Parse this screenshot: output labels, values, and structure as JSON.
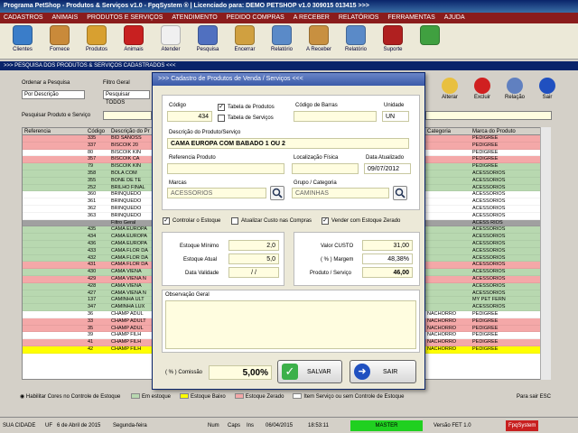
{
  "window": {
    "title": "Programa PetShop - Produtos & Serviços v1.0 - FpqSystem ® | Licenciado para: DEMO PETSHOP v1.0 309015 013415 >>>"
  },
  "menu": [
    "CADASTROS",
    "ANIMAIS",
    "PRODUTOS E SERVIÇOS",
    "ATENDIMENTO",
    "PEDIDO COMPRAS",
    "A RECEBER",
    "RELATÓRIOS",
    "FERRAMENTAS",
    "AJUDA"
  ],
  "toolbar": [
    {
      "label": "Clientes",
      "icon": "people-icon",
      "color": "#3a7dc9"
    },
    {
      "label": "Fornece",
      "icon": "supplier-icon",
      "color": "#c98a3a"
    },
    {
      "label": "Produtos",
      "icon": "boxes-icon",
      "color": "#d8a030"
    },
    {
      "label": "Animais",
      "icon": "paw-icon",
      "color": "#c82020"
    },
    {
      "label": "Atender",
      "icon": "vet-cross-icon",
      "color": "#f0f0f0"
    },
    {
      "label": "Pesquisa",
      "icon": "search-doc-icon",
      "color": "#5070c0"
    },
    {
      "label": "Encerrar",
      "icon": "folder-icon",
      "color": "#d0a040"
    },
    {
      "label": "Relatório",
      "icon": "report-icon",
      "color": "#5a8ac8"
    },
    {
      "label": "A Receber",
      "icon": "money-icon",
      "color": "#c89040"
    },
    {
      "label": "Relatório",
      "icon": "report-icon",
      "color": "#5a8ac8"
    },
    {
      "label": "Suporte",
      "icon": "support-icon",
      "color": "#b02020"
    },
    {
      "label": "",
      "icon": "exit-icon",
      "color": "#40a040"
    }
  ],
  "search_bar": {
    "title": ">>>  PESQUISA DOS PRODUTOS & SERVIÇOS CADASTRADOS  <<<"
  },
  "filters": {
    "order_label": "Ordenar a Pesquisa",
    "order_value": "Por Descrição",
    "filter_label": "Filtro Geral",
    "filter_value": "Pesquisar TODOS",
    "search_label": "Pesquisar Produto e Serviço"
  },
  "actions": [
    {
      "label": "Alterar",
      "icon": "edit-icon",
      "color": "#e8c040"
    },
    {
      "label": "Excluir",
      "icon": "delete-icon",
      "color": "#d02020"
    },
    {
      "label": "Relação",
      "icon": "print-icon",
      "color": "#6080c0"
    },
    {
      "label": "Sair",
      "icon": "exit-arrow-icon",
      "color": "#2050c0"
    }
  ],
  "grid": {
    "headers": [
      "Referencia",
      "Código",
      "Descrição do Pr",
      "Categoria",
      "Marca do Produto"
    ],
    "rows": [
      {
        "code": "335",
        "desc": "BID SANOSS",
        "cat": "",
        "brand": "PEDIGREE",
        "color": "#f4a8a8"
      },
      {
        "code": "337",
        "desc": "BISCOIK 20",
        "cat": "",
        "brand": "PEDIGREE",
        "color": "#f4a8a8"
      },
      {
        "code": "80",
        "desc": "BISCOIK KIN",
        "cat": "",
        "brand": "PEDIGREE",
        "color": "#ffffff"
      },
      {
        "code": "357",
        "desc": "BISCOIK CA",
        "cat": "",
        "brand": "PEDIGREE",
        "color": "#f4a8a8"
      },
      {
        "code": "79",
        "desc": "BISCOIK KIN",
        "cat": "",
        "brand": "PEDIGREE",
        "color": "#b8d8b0"
      },
      {
        "code": "358",
        "desc": "BOLA COM",
        "cat": "",
        "brand": "ACESSORIOS",
        "color": "#b8d8b0"
      },
      {
        "code": "355",
        "desc": "BONE DE TE",
        "cat": "",
        "brand": "ACESSORIOS",
        "color": "#b8d8b0"
      },
      {
        "code": "252",
        "desc": "BRILHO FINAL",
        "cat": "",
        "brand": "ACESSORIOS",
        "color": "#b8d8b0"
      },
      {
        "code": "360",
        "desc": "BRINQUEDO",
        "cat": "",
        "brand": "ACESSORIOS",
        "color": "#ffffff"
      },
      {
        "code": "361",
        "desc": "BRINQUEDO",
        "cat": "",
        "brand": "ACESSORIOS",
        "color": "#ffffff"
      },
      {
        "code": "362",
        "desc": "BRINQUEDO",
        "cat": "",
        "brand": "ACESSORIOS",
        "color": "#ffffff"
      },
      {
        "code": "363",
        "desc": "BRINQUEDO",
        "cat": "",
        "brand": "ACESSORIOS",
        "color": "#ffffff"
      },
      {
        "code": "",
        "desc": "Filtro Geral",
        "cat": "",
        "brand": "ACESS RIOS",
        "color": "#a0a0a0"
      },
      {
        "code": "435",
        "desc": "CAMA EUROPA",
        "cat": "",
        "brand": "ACESSORIOS",
        "color": "#b8d8b0"
      },
      {
        "code": "434",
        "desc": "CAMA EUROPA",
        "cat": "",
        "brand": "ACESSORIOS",
        "color": "#b8d8b0"
      },
      {
        "code": "436",
        "desc": "CAMA EUROPA",
        "cat": "",
        "brand": "ACESSORIOS",
        "color": "#b8d8b0"
      },
      {
        "code": "433",
        "desc": "CAMA FLOR DA",
        "cat": "",
        "brand": "ACESSORIOS",
        "color": "#b8d8b0"
      },
      {
        "code": "432",
        "desc": "CAMA FLOR DA",
        "cat": "",
        "brand": "ACESSORIOS",
        "color": "#b8d8b0"
      },
      {
        "code": "431",
        "desc": "CAMA FLOR DA",
        "cat": "",
        "brand": "ACESSORIOS",
        "color": "#f4a8a8"
      },
      {
        "code": "430",
        "desc": "CAMA VIENA",
        "cat": "",
        "brand": "ACESSORIOS",
        "color": "#b8d8b0"
      },
      {
        "code": "429",
        "desc": "CAMA VIENA N",
        "cat": "",
        "brand": "ACESSORIOS",
        "color": "#f4a8a8"
      },
      {
        "code": "428",
        "desc": "CAMA VIENA",
        "cat": "",
        "brand": "ACESSORIOS",
        "color": "#b8d8b0"
      },
      {
        "code": "427",
        "desc": "CAMA VIENA N",
        "cat": "",
        "brand": "ACESSORIOS",
        "color": "#b8d8b0"
      },
      {
        "code": "137",
        "desc": "CAMINHA ULT",
        "cat": "",
        "brand": "MY PET FERN",
        "color": "#b8d8b0"
      },
      {
        "code": "347",
        "desc": "CAMINHA LUX",
        "cat": "",
        "brand": "ACESSORIOS",
        "color": "#b8d8b0"
      },
      {
        "code": "36",
        "desc": "CHAMP ADUL",
        "cat": "NACHORRO",
        "brand": "PEDIGREE",
        "color": "#ffffff"
      },
      {
        "code": "33",
        "desc": "CHAMP ADULT",
        "cat": "NACHORRO",
        "brand": "PEDIGREE",
        "color": "#f4a8a8"
      },
      {
        "code": "35",
        "desc": "CHAMP ADUL",
        "cat": "NACHORRO",
        "brand": "PEDIGREE",
        "color": "#f4a8a8"
      },
      {
        "code": "39",
        "desc": "CHAMP FILH",
        "cat": "NACHORRO",
        "brand": "PEDIGREE",
        "color": "#ffffff"
      },
      {
        "code": "41",
        "desc": "CHAMP FILH",
        "cat": "NACHORRO",
        "brand": "PEDIGREE",
        "color": "#f4a8a8"
      },
      {
        "code": "42",
        "desc": "CHAMP FILH",
        "cat": "NACHORRO",
        "brand": "PEDIGREE",
        "color": "#ffff00"
      }
    ]
  },
  "legend": {
    "habilitar": "Habilitar Cores no Controle de Estoque",
    "items": [
      {
        "label": "Em estoque",
        "color": "#b8d8b0"
      },
      {
        "label": "Estoque Baixo",
        "color": "#ffff00"
      },
      {
        "label": "Estoque Zerado",
        "color": "#f4a8a8"
      },
      {
        "label": "Item Serviço ou sem Controle de Estoque",
        "color": "#ffffff"
      }
    ],
    "esc": "Para sair ESC"
  },
  "status": {
    "city": "SUA CIDADE",
    "uf": "UF",
    "date_text": "6 de Abril de 2015",
    "weekday": "Segunda-feira",
    "num": "Num",
    "caps": "Caps",
    "ins": "Ins",
    "date": "06/04/2015",
    "time": "18:53:11",
    "master": "MASTER",
    "version": "Versão FET 1.0",
    "brand": "FpqSystem"
  },
  "dialog": {
    "title": ">>>  Cadastro de Produtos de Venda / Serviços  <<<",
    "codigo_label": "Código",
    "codigo": "434",
    "tabela_produtos": "Tabela de Produtos",
    "tabela_servicos": "Tabela de Serviços",
    "barras_label": "Código de Barras",
    "barras": "",
    "unidade_label": "Unidade",
    "unidade": "UN",
    "descricao_label": "Descrição do Produto/Serviço",
    "descricao": "CAMA EUROPA COM BABADO 1 OU 2",
    "referencia_label": "Referencia Produto",
    "referencia": "",
    "local_label": "Localização Física",
    "local": "",
    "data_label": "Data Atualizado",
    "data": "09/07/2012",
    "marcas_label": "Marcas",
    "marcas": "ACESSORIOS",
    "grupo_label": "Grupo / Categoria",
    "grupo": "CAMINHAS",
    "controlar": "Controlar o Estoque",
    "atualizar": "Atualizar Custo nas Compras",
    "vender": "Vender com Estoque Zerado",
    "min_label": "Estoque Mínimo",
    "min": "2,0",
    "atual_label": "Estoque Atual",
    "atual": "5,0",
    "validade_label": "Data Validade",
    "validade": " / /",
    "custo_label": "Valor CUSTO",
    "custo": "31,00",
    "margem_label": "( % ) Margem",
    "margem": "48,38%",
    "preco_label": "Produto / Serviço",
    "preco": "46,00",
    "obs_label": "Observação Geral",
    "comissao_label": "( % ) Comissão",
    "comissao": "5,00%",
    "salvar": "SALVAR",
    "sair": "SAIR"
  }
}
